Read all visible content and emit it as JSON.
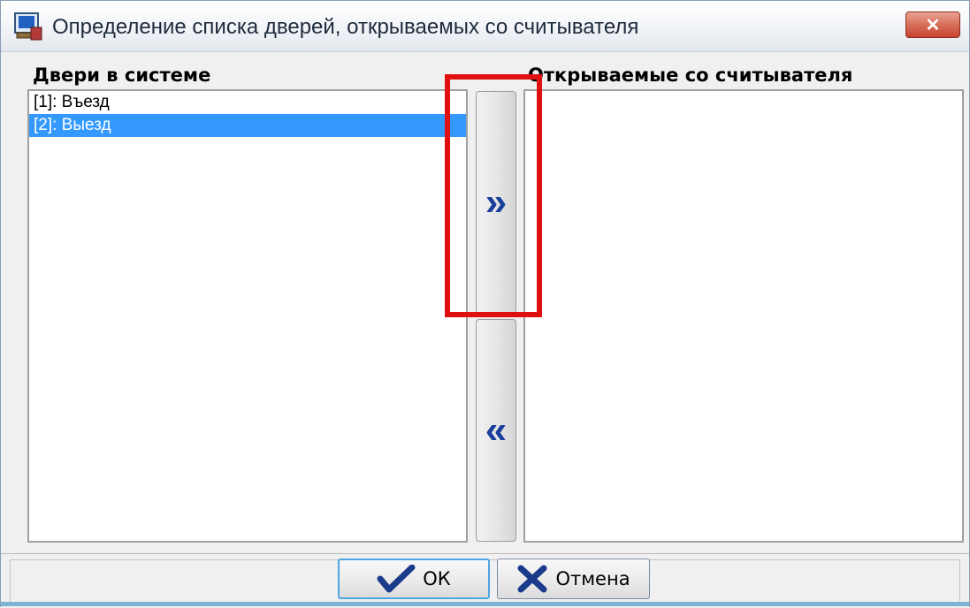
{
  "window": {
    "title": "Определение списка дверей, открываемых со считывателя",
    "close_label": "✕"
  },
  "left_panel": {
    "label": "Двери в системе",
    "items": [
      {
        "text": "[1]: Въезд",
        "selected": false
      },
      {
        "text": "[2]: Выезд",
        "selected": true
      }
    ]
  },
  "right_panel": {
    "label": "Открываемые со считывателя",
    "items": []
  },
  "buttons": {
    "add_glyph": "»",
    "remove_glyph": "«",
    "ok_label": "ОК",
    "cancel_label": "Отмена"
  },
  "colors": {
    "selection": "#3399ff",
    "highlight": "#e01010",
    "arrow": "#1a3f9a"
  },
  "icons": {
    "app": "app-computer-icon",
    "ok": "checkmark-icon",
    "cancel": "cross-icon"
  }
}
